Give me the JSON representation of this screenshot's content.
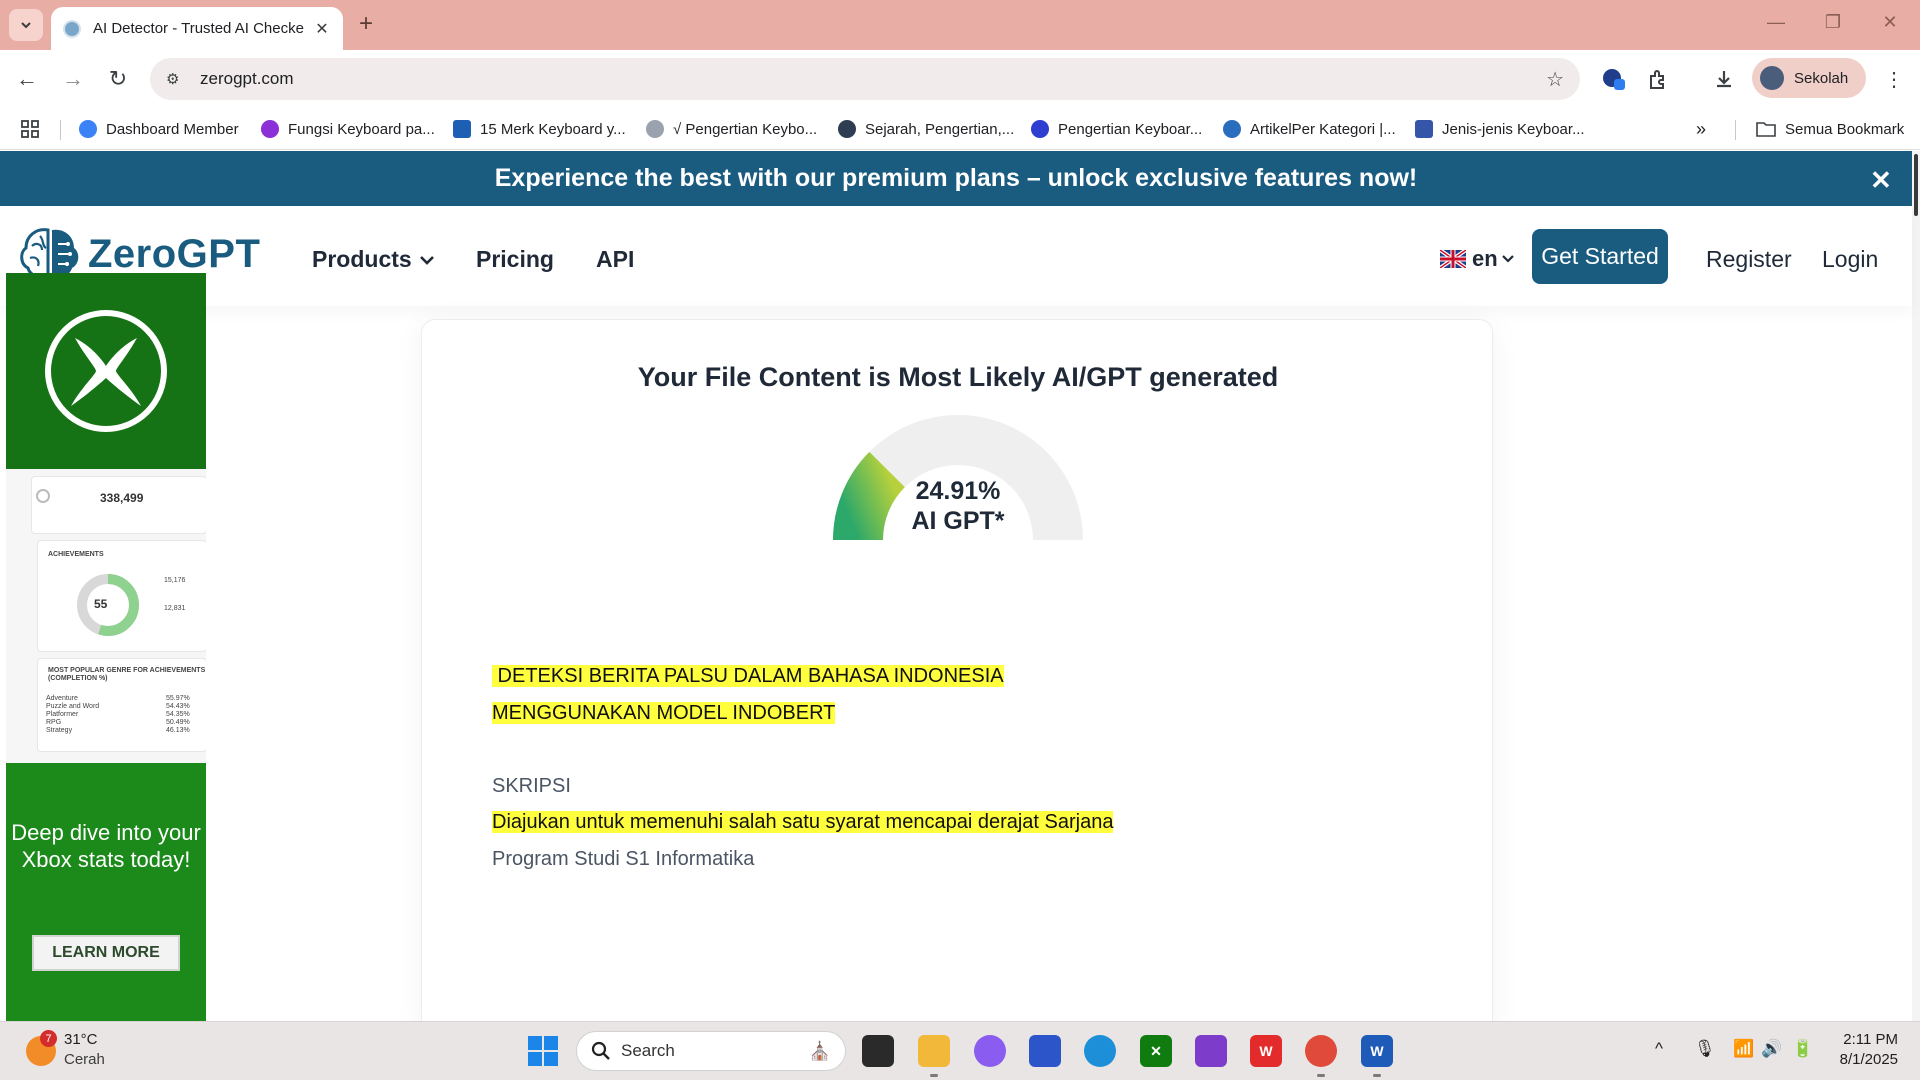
{
  "browser": {
    "tab": {
      "title": "AI Detector - Trusted AI Checke",
      "favicon": "zerogpt-favicon"
    },
    "url": "zerogpt.com",
    "profile_name": "Sekolah",
    "bookmarks": [
      {
        "label": "Dashboard Member",
        "color": "#3b82f6"
      },
      {
        "label": "Fungsi Keyboard pa...",
        "color": "#8b2fd6"
      },
      {
        "label": "15 Merk Keyboard y...",
        "color": "#1d5fb3"
      },
      {
        "label": "√ Pengertian Keybo...",
        "color": "#9aa3ad"
      },
      {
        "label": "Sejarah, Pengertian,...",
        "color": "#2f3d52"
      },
      {
        "label": "Pengertian Keyboar...",
        "color": "#2d3fd0"
      },
      {
        "label": "ArtikelPer Kategori |...",
        "color": "#2a6dbf"
      },
      {
        "label": "Jenis-jenis Keyboar...",
        "color": "#3556a8"
      }
    ],
    "all_bookmarks": "Semua Bookmark"
  },
  "page": {
    "promo": "Experience the best with our premium plans – unlock exclusive features now!",
    "logo": "ZeroGPT",
    "nav": {
      "products": "Products",
      "pricing": "Pricing",
      "api": "API"
    },
    "lang": "en",
    "get_started": "Get Started",
    "register": "Register",
    "login": "Login",
    "accent_color": "#1a5b80"
  },
  "ad": {
    "stat_main": "338,499",
    "achievements": "ACHIEVEMENTS",
    "donut_value": "55",
    "stat_a": "15,176",
    "stat_b": "12,831",
    "popular": "MOST POPULAR GENRE FOR ACHIEVEMENTS (COMPLETION %)",
    "genres": [
      "Adventure",
      "Puzzle and Word",
      "Platformer",
      "RPG",
      "Strategy"
    ],
    "genre_pcts": [
      "55.97%",
      "54.43%",
      "54.35%",
      "50.49%",
      "46.13%"
    ],
    "headline": "Deep dive into your Xbox stats today!",
    "cta": "LEARN MORE"
  },
  "result": {
    "title": "Your File Content is Most Likely AI/GPT generated",
    "ai_percent": 24.91,
    "percent_text": "24.91%",
    "label": "AI GPT*",
    "lines": [
      {
        "text": " DETEKSI BERITA PALSU DALAM BAHASA INDONESIA",
        "highlighted": true
      },
      {
        "text": "MENGGUNAKAN MODEL INDOBERT",
        "highlighted": true
      },
      {
        "text": "SKRIPSI",
        "highlighted": false
      },
      {
        "text": "Diajukan untuk memenuhi salah satu syarat mencapai derajat Sarjana",
        "highlighted": true
      },
      {
        "text": "Program Studi S1 Informatika",
        "highlighted": false
      }
    ]
  },
  "taskbar": {
    "weather_badge": "7",
    "temperature": "31°C",
    "condition": "Cerah",
    "search_label": "Search",
    "time": "2:11 PM",
    "date": "8/1/2025"
  }
}
